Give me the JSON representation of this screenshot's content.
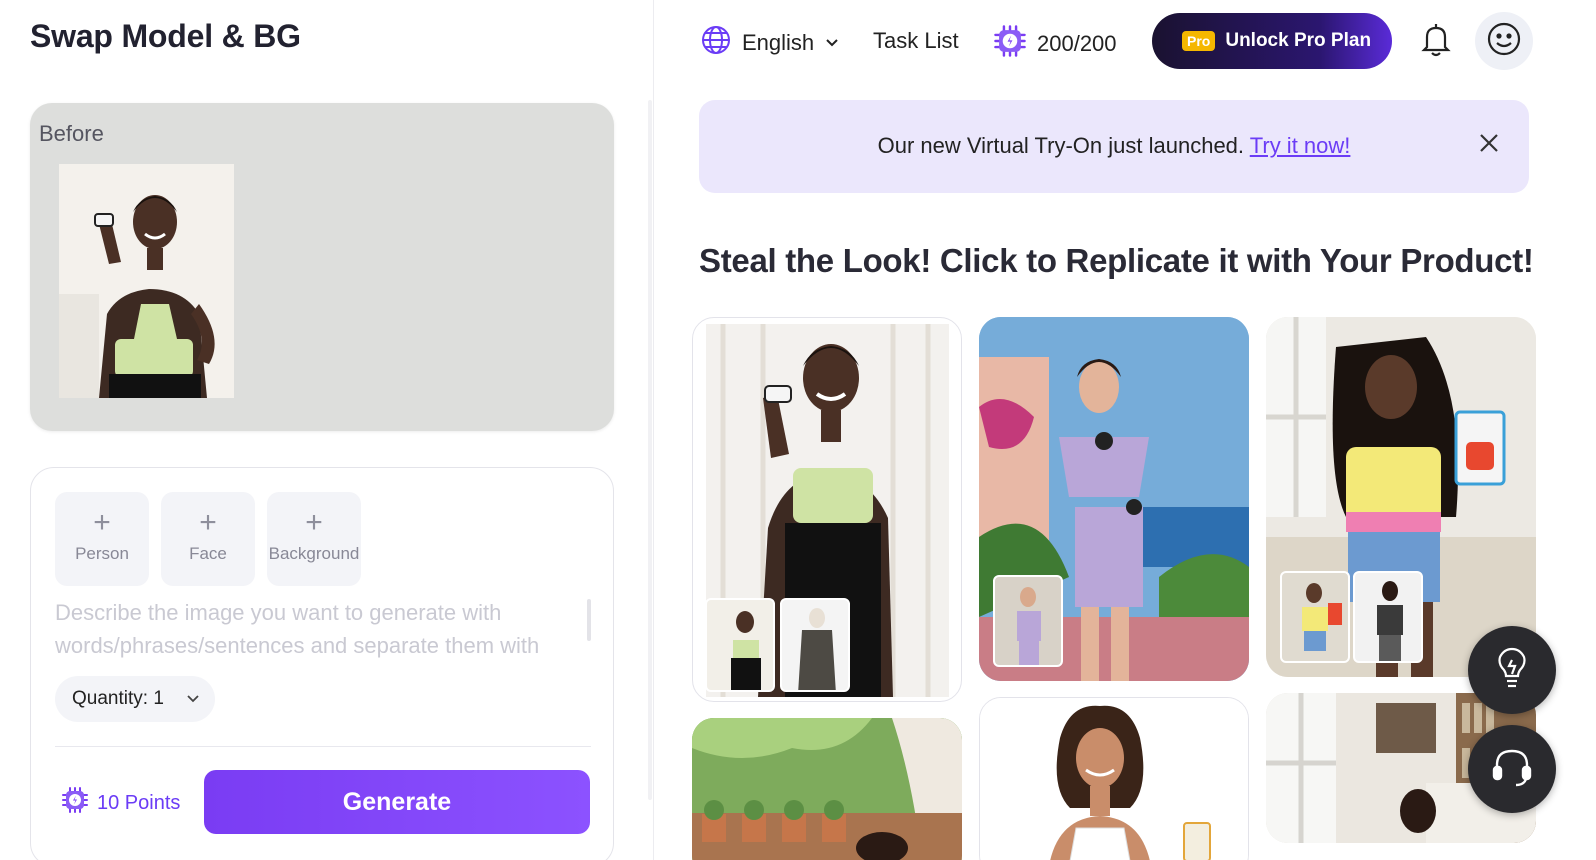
{
  "app": {
    "title": "Swap Model & BG"
  },
  "before": {
    "label": "Before"
  },
  "slots": [
    {
      "label": "Person"
    },
    {
      "label": "Face"
    },
    {
      "label": "Background"
    }
  ],
  "prompt": {
    "placeholder": "Describe the image you want to generate with words/phrases/sentences and separate them with"
  },
  "quantity": {
    "label": "Quantity: 1"
  },
  "cost": {
    "label": "10 Points"
  },
  "generate": {
    "label": "Generate"
  },
  "topbar": {
    "language": "English",
    "task_list": "Task List",
    "credits": "200/200",
    "pro_badge": "Pro",
    "pro_label": "Unlock Pro Plan"
  },
  "banner": {
    "text": "Our new Virtual Try-On just launched. ",
    "link": "Try it now!"
  },
  "gallery": {
    "headline": "Steal the Look! Click to Replicate it with Your Product!"
  },
  "colors": {
    "accent": "#7a3cf3",
    "banner_bg": "#ebe7fc",
    "pro_badge": "#f5b700"
  },
  "icons": [
    "globe-icon",
    "chevron-down-icon",
    "credit-chip-icon",
    "bell-icon",
    "smiley-icon",
    "close-icon",
    "lightbulb-icon",
    "headset-icon",
    "plus-icon"
  ]
}
